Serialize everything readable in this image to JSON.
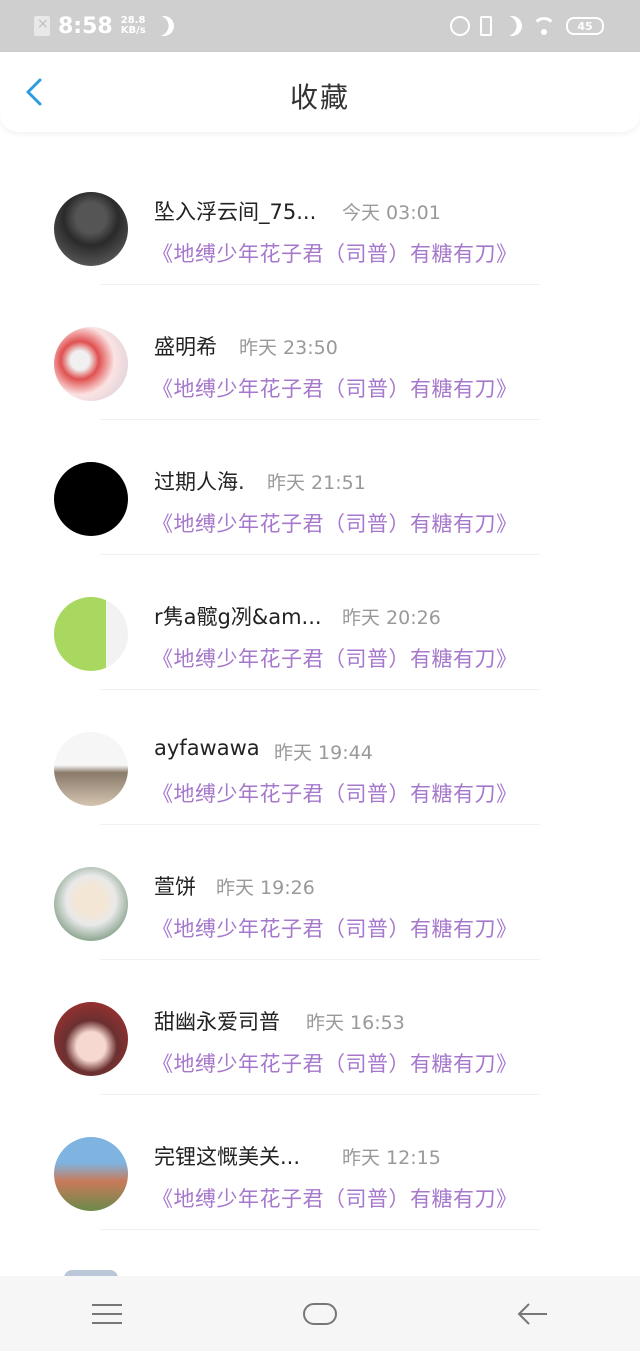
{
  "status_bar": {
    "time": "8:58",
    "speed_value": "28.8",
    "speed_unit": "KB/s",
    "battery": "45"
  },
  "header": {
    "title": "收藏"
  },
  "items": [
    {
      "name": "坠入浮云间_75...",
      "time": "今天 03:01",
      "collection": "《地缚少年花子君（司普）有糖有刀》"
    },
    {
      "name": "盛明希",
      "time": "昨天 23:50",
      "collection": "《地缚少年花子君（司普）有糖有刀》"
    },
    {
      "name": "过期人海.",
      "time": "昨天 21:51",
      "collection": "《地缚少年花子君（司普）有糖有刀》"
    },
    {
      "name": "r隽a髋g冽&am...",
      "time": "昨天 20:26",
      "collection": "《地缚少年花子君（司普）有糖有刀》"
    },
    {
      "name": "ayfawawa",
      "time": "昨天 19:44",
      "collection": "《地缚少年花子君（司普）有糖有刀》"
    },
    {
      "name": "萱饼",
      "time": "昨天 19:26",
      "collection": "《地缚少年花子君（司普）有糖有刀》"
    },
    {
      "name": "甜幽永爱司普",
      "time": "昨天 16:53",
      "collection": "《地缚少年花子君（司普）有糖有刀》"
    },
    {
      "name": "完锂这慨美关...",
      "time": "昨天 12:15",
      "collection": "《地缚少年花子君（司普）有糖有刀》"
    }
  ],
  "colors": {
    "accent": "#2d9be0",
    "link_purple": "#a678cc",
    "status_bar_bg": "#cfcfcf"
  },
  "icons": {
    "back": "chevron-left-icon",
    "nav_menu": "menu-icon",
    "nav_home": "home-icon",
    "nav_back": "back-arrow-icon"
  }
}
